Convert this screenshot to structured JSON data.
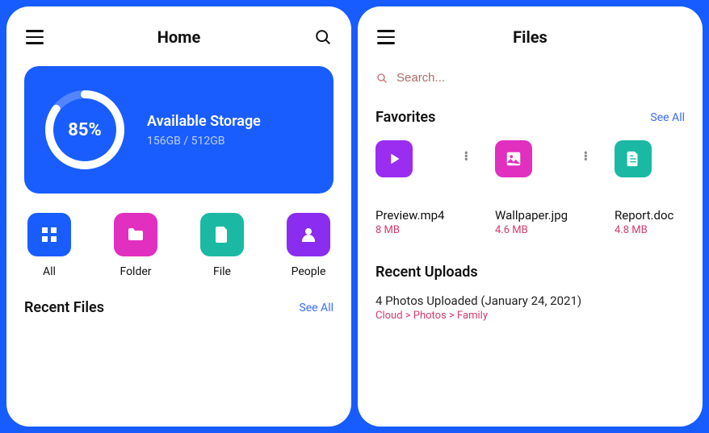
{
  "home": {
    "title": "Home",
    "storage": {
      "percent_label": "85%",
      "percent": 85,
      "title": "Available Storage",
      "detail": "156GB / 512GB"
    },
    "categories": [
      {
        "label": "All",
        "color": "#1a5dff",
        "icon": "grid"
      },
      {
        "label": "Folder",
        "color": "#e12fc0",
        "icon": "folder"
      },
      {
        "label": "File",
        "color": "#1bb9a4",
        "icon": "file"
      },
      {
        "label": "People",
        "color": "#8a2df0",
        "icon": "person"
      }
    ],
    "recent_files": {
      "title": "Recent Files",
      "see_all": "See All"
    }
  },
  "files": {
    "title": "Files",
    "search_placeholder": "Search...",
    "favorites": {
      "title": "Favorites",
      "see_all": "See All",
      "items": [
        {
          "name": "Preview.mp4",
          "size": "8 MB",
          "color": "#9a2df0",
          "icon": "play"
        },
        {
          "name": "Wallpaper.jpg",
          "size": "4.6 MB",
          "color": "#e12fc0",
          "icon": "image"
        },
        {
          "name": "Report.doc",
          "size": "4.8 MB",
          "color": "#1bb9a4",
          "icon": "doc"
        }
      ]
    },
    "recent_uploads": {
      "title": "Recent Uploads",
      "entry_title": "4 Photos Uploaded (January 24, 2021)",
      "entry_path": "Cloud > Photos > Family"
    }
  }
}
